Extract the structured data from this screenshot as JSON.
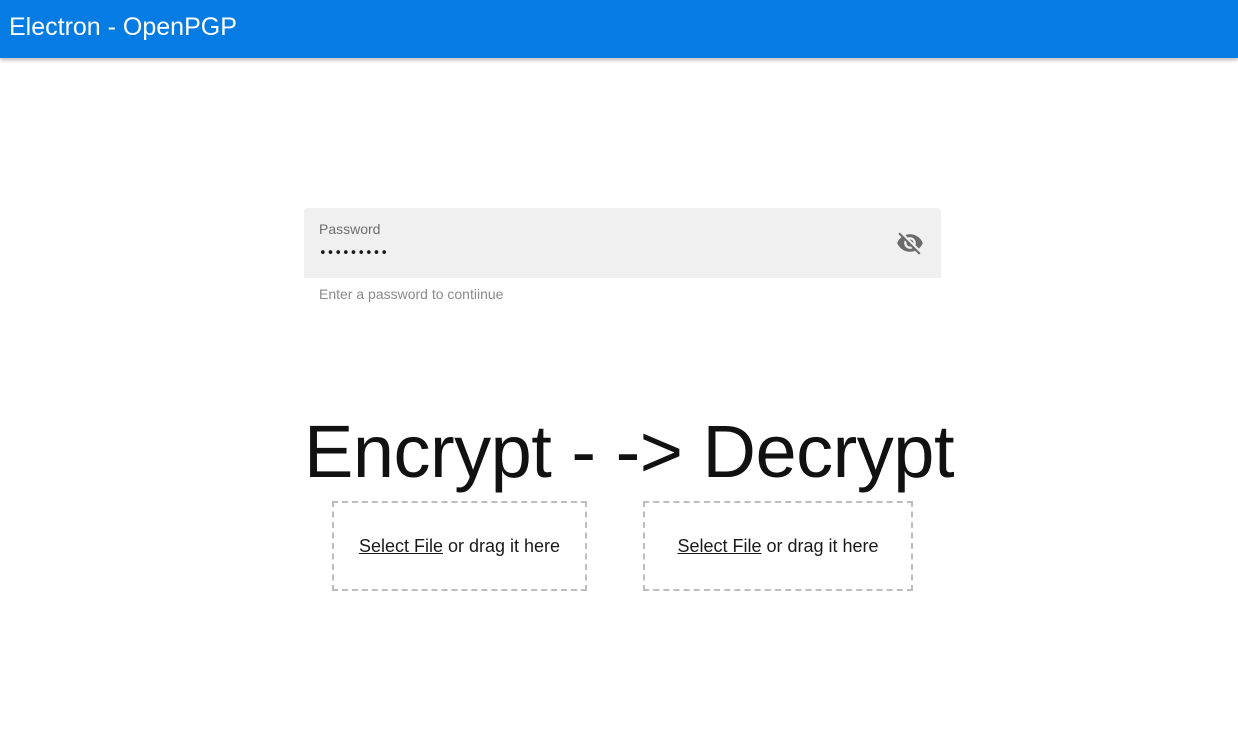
{
  "app_bar": {
    "title": "Electron - OpenPGP",
    "color": "#047ce3"
  },
  "password": {
    "label": "Password",
    "value": "•••••••••",
    "hint": "Enter a password to contiinue",
    "toggle_icon": "visibility-off-icon"
  },
  "heading": {
    "text": "Encrypt -  -> Decrypt"
  },
  "drop_zones": [
    {
      "link": "Select File",
      "rest": "or drag it here"
    },
    {
      "link": "Select File",
      "rest": "or drag it here"
    }
  ]
}
